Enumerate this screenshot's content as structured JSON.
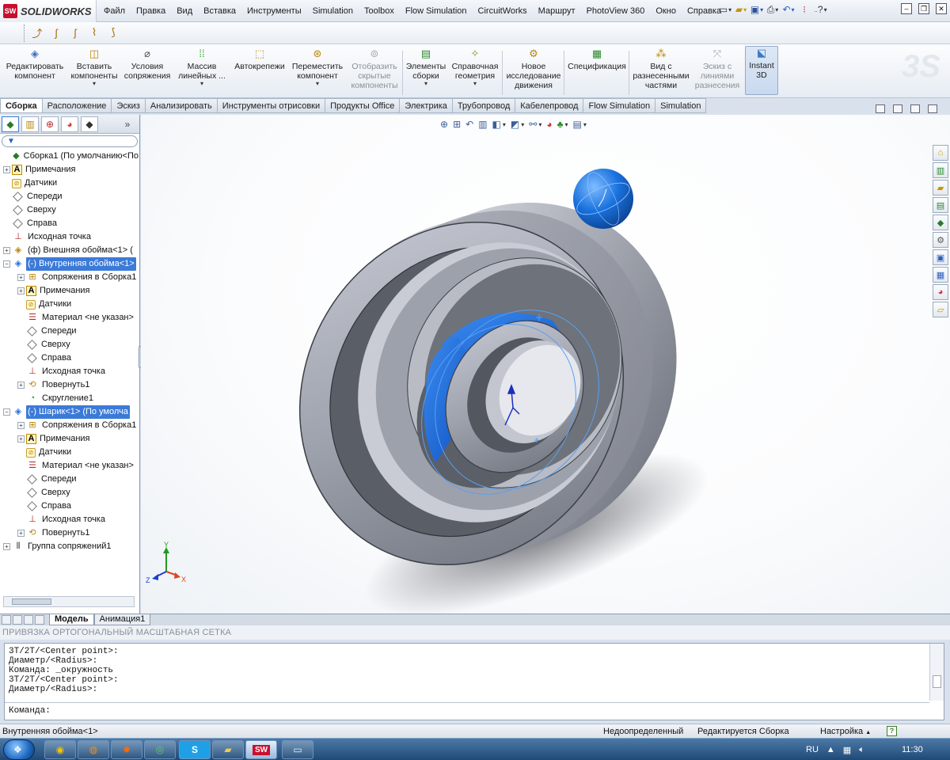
{
  "app": {
    "logo_text": "SOLIDWORKS",
    "logo_mark": "SW"
  },
  "menu": [
    "Файл",
    "Правка",
    "Вид",
    "Вставка",
    "Инструменты",
    "Simulation",
    "Toolbox",
    "Flow Simulation",
    "CircuitWorks",
    "Маршрут",
    "PhotoView 360",
    "Окно",
    "Справка"
  ],
  "quickbar": {
    "help_label": "?",
    "icons": [
      "new-doc-icon",
      "open-folder-icon",
      "save-icon",
      "print-icon",
      "undo-icon",
      "rebuild-icon",
      "options-icon"
    ]
  },
  "command_manager": {
    "buttons": [
      {
        "label": "Редактировать компонент",
        "icon": "edit-component-icon",
        "enabled": true
      },
      {
        "label": "Вставить компоненты",
        "icon": "insert-components-icon",
        "enabled": true,
        "dropdown": true
      },
      {
        "label": "Условия сопряжения",
        "icon": "mate-icon",
        "enabled": true
      },
      {
        "label": "Массив линейных ...",
        "icon": "linear-pattern-icon",
        "enabled": true,
        "dropdown": true
      },
      {
        "label": "Автокрепежи",
        "icon": "smart-fasteners-icon",
        "enabled": true
      },
      {
        "label": "Переместить компонент",
        "icon": "move-component-icon",
        "enabled": true,
        "dropdown": true
      },
      {
        "label": "Отобразить скрытые компоненты",
        "icon": "show-hidden-icon",
        "enabled": false
      },
      {
        "label": "Элементы сборки",
        "icon": "assembly-features-icon",
        "enabled": true,
        "dropdown": true
      },
      {
        "label": "Справочная геометрия",
        "icon": "reference-geometry-icon",
        "enabled": true,
        "dropdown": true
      },
      {
        "label": "Новое исследование движения",
        "icon": "motion-study-icon",
        "enabled": true
      },
      {
        "label": "Спецификация",
        "icon": "bom-icon",
        "enabled": true
      },
      {
        "label": "Вид с разнесенными частями",
        "icon": "exploded-view-icon",
        "enabled": true
      },
      {
        "label": "Эскиз с линиями разнесения",
        "icon": "explode-line-sketch-icon",
        "enabled": false
      },
      {
        "label": "Instant 3D",
        "icon": "instant3d-icon",
        "enabled": true,
        "active": true
      }
    ],
    "tabs": [
      "Сборка",
      "Расположение",
      "Эскиз",
      "Анализировать",
      "Инструменты отрисовки",
      "Продукты Office",
      "Электрика",
      "Трубопровод",
      "Кабелепровод",
      "Flow Simulation",
      "Simulation"
    ],
    "active_tab": "Сборка"
  },
  "feature_tree": {
    "filter_icon": "filter-icon",
    "collapse_label": "»",
    "nodes": [
      {
        "level": 0,
        "expander": "",
        "icon": "assembly",
        "label": "Сборка1  (По умолчанию<По"
      },
      {
        "level": 0,
        "expander": "+",
        "icon": "annotation",
        "label": "Примечания"
      },
      {
        "level": 0,
        "expander": "",
        "icon": "sensor",
        "label": "Датчики"
      },
      {
        "level": 0,
        "expander": "",
        "icon": "plane",
        "label": "Спереди"
      },
      {
        "level": 0,
        "expander": "",
        "icon": "plane",
        "label": "Сверху"
      },
      {
        "level": 0,
        "expander": "",
        "icon": "plane",
        "label": "Справа"
      },
      {
        "level": 0,
        "expander": "",
        "icon": "origin",
        "label": "Исходная точка"
      },
      {
        "level": 0,
        "expander": "+",
        "icon": "part",
        "label": "(ф) Внешняя обойма<1> ("
      },
      {
        "level": 0,
        "expander": "−",
        "icon": "part-blue",
        "label": "(-) Внутренняя обойма<1>",
        "selected": true
      },
      {
        "level": 1,
        "expander": "+",
        "icon": "mate-folder",
        "label": "Сопряжения в Сборка1"
      },
      {
        "level": 1,
        "expander": "+",
        "icon": "annotation",
        "label": "Примечания"
      },
      {
        "level": 1,
        "expander": "",
        "icon": "sensor",
        "label": "Датчики"
      },
      {
        "level": 1,
        "expander": "",
        "icon": "material",
        "label": "Материал <не указан>"
      },
      {
        "level": 1,
        "expander": "",
        "icon": "plane",
        "label": "Спереди"
      },
      {
        "level": 1,
        "expander": "",
        "icon": "plane",
        "label": "Сверху"
      },
      {
        "level": 1,
        "expander": "",
        "icon": "plane",
        "label": "Справа"
      },
      {
        "level": 1,
        "expander": "",
        "icon": "origin",
        "label": "Исходная точка"
      },
      {
        "level": 1,
        "expander": "+",
        "icon": "revolve",
        "label": "Повернуть1"
      },
      {
        "level": 1,
        "expander": "",
        "icon": "fillet",
        "label": "Скругление1"
      },
      {
        "level": 0,
        "expander": "−",
        "icon": "part-blue",
        "label": "(-) Шарик<1> (По умолча",
        "selected": true
      },
      {
        "level": 1,
        "expander": "+",
        "icon": "mate-folder",
        "label": "Сопряжения в Сборка1"
      },
      {
        "level": 1,
        "expander": "+",
        "icon": "annotation",
        "label": "Примечания"
      },
      {
        "level": 1,
        "expander": "",
        "icon": "sensor",
        "label": "Датчики"
      },
      {
        "level": 1,
        "expander": "",
        "icon": "material",
        "label": "Материал <не указан>"
      },
      {
        "level": 1,
        "expander": "",
        "icon": "plane",
        "label": "Спереди"
      },
      {
        "level": 1,
        "expander": "",
        "icon": "plane",
        "label": "Сверху"
      },
      {
        "level": 1,
        "expander": "",
        "icon": "plane",
        "label": "Справа"
      },
      {
        "level": 1,
        "expander": "",
        "icon": "origin",
        "label": "Исходная точка"
      },
      {
        "level": 1,
        "expander": "+",
        "icon": "revolve",
        "label": "Повернуть1"
      },
      {
        "level": 0,
        "expander": "+",
        "icon": "mates",
        "label": "Группа сопряжений1"
      }
    ]
  },
  "viewport": {
    "triad_labels": {
      "x": "X",
      "y": "Y",
      "z": "Z"
    },
    "colors": {
      "ring_body": "#a9aeb9",
      "ring_dark": "#52565f",
      "inner_blue": "#1f6ae0",
      "sphere_blue": "#1877e6",
      "sketch_line": "#5aa0f0"
    }
  },
  "bottom_tabs": [
    "Модель",
    "Анимация1"
  ],
  "active_bottom_tab": "Модель",
  "snap_options": "ПРИВЯЗКА  ОРТОГОНАЛЬНЫЙ  МАСШТАБНАЯ СЕТКА",
  "command_window": {
    "log": [
      "3T/2T/<Center point>:",
      "Диаметр/<Radius>:",
      "Команда: _окружность",
      "3T/2T/<Center point>:",
      "Диаметр/<Radius>:"
    ],
    "prompt": "Команда:"
  },
  "status_bar": {
    "selection": "Внутренняя обойма<1>",
    "definition": "Недоопределенный",
    "mode": "Редактируется Сборка",
    "settings": "Настройка",
    "settings_arrow": "▲",
    "help": "?"
  },
  "taskbar": {
    "buttons": [
      "chrome-icon",
      "firefox-icon",
      "settings-app-icon",
      "app-green-icon",
      "skype-icon",
      "explorer-folder-icon",
      "solidworks-icon",
      "notepad-icon"
    ],
    "language": "RU",
    "clock": "11:30"
  }
}
